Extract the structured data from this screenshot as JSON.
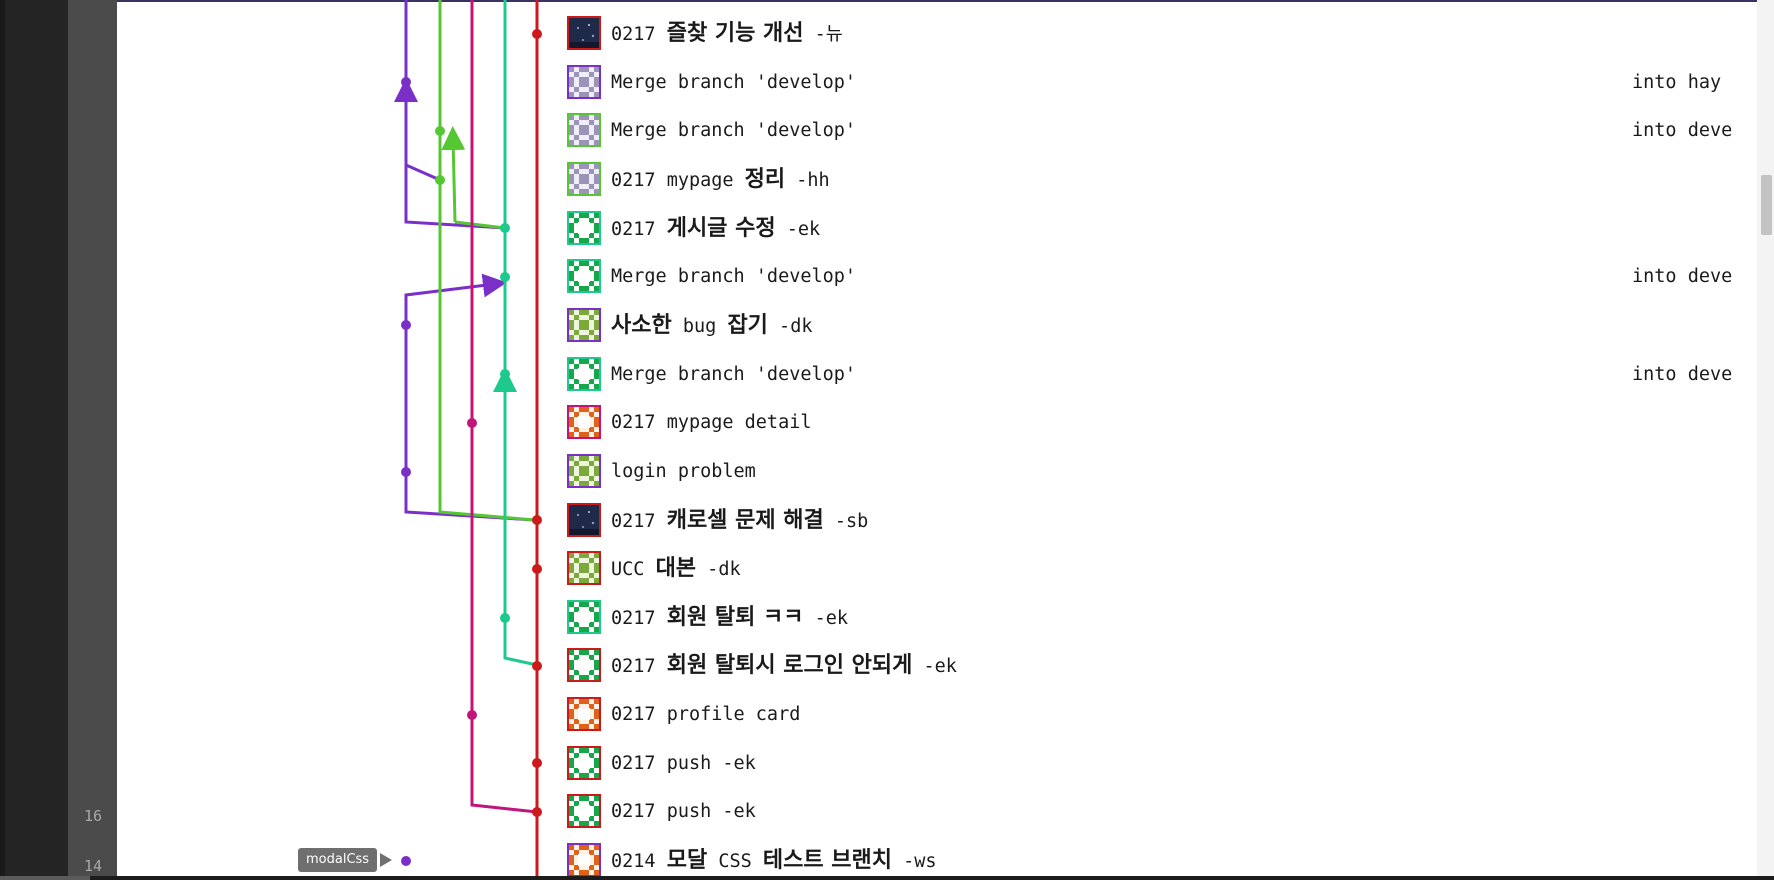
{
  "gutter": {
    "line_numbers": [
      "16",
      "14"
    ]
  },
  "tag": {
    "label": "modalCss"
  },
  "colors": {
    "purple": "#7a2fc9",
    "green": "#55c732",
    "magenta": "#c2147a",
    "teal": "#1dc98c",
    "red": "#cc1a1a"
  },
  "commits": [
    {
      "p": "0217 ",
      "k": "즐찾 기능 개선",
      "s": " -뉴",
      "into": "",
      "avatar": "photo",
      "frame": "#cc1a1a"
    },
    {
      "p": "Merge branch 'develop'",
      "k": "",
      "s": "",
      "into": "into hay",
      "avatar": "lavender",
      "frame": "#7a2fc9"
    },
    {
      "p": "Merge branch 'develop'",
      "k": "",
      "s": "",
      "into": "into deve",
      "avatar": "lavender",
      "frame": "#55c732"
    },
    {
      "p": "0217 mypage ",
      "k": "정리",
      "s": " -hh",
      "into": "",
      "avatar": "lavender",
      "frame": "#55c732"
    },
    {
      "p": "0217 ",
      "k": "게시글 수정",
      "s": " -ek",
      "into": "",
      "avatar": "green",
      "frame": "#1dc98c"
    },
    {
      "p": "Merge branch 'develop'",
      "k": "",
      "s": "",
      "into": "into deve",
      "avatar": "green",
      "frame": "#1dc98c"
    },
    {
      "p": "",
      "k": "사소한",
      "s": " bug ",
      "k2": "잡기",
      "s2": " -dk",
      "into": "",
      "avatar": "olive",
      "frame": "#7a2fc9"
    },
    {
      "p": "Merge branch 'develop'",
      "k": "",
      "s": "",
      "into": "into deve",
      "avatar": "green",
      "frame": "#1dc98c"
    },
    {
      "p": "0217 mypage detail",
      "k": "",
      "s": "",
      "into": "",
      "avatar": "orange",
      "frame": "#c2147a"
    },
    {
      "p": "login problem",
      "k": "",
      "s": "",
      "into": "",
      "avatar": "olive",
      "frame": "#7a2fc9"
    },
    {
      "p": "0217 ",
      "k": "캐로셀 문제 해결",
      "s": " -sb",
      "into": "",
      "avatar": "photo",
      "frame": "#cc1a1a"
    },
    {
      "p": "UCC ",
      "k": "대본",
      "s": " -dk",
      "into": "",
      "avatar": "olive",
      "frame": "#cc1a1a"
    },
    {
      "p": "0217 ",
      "k": "회원 탈퇴 ㅋㅋ",
      "s": " -ek",
      "into": "",
      "avatar": "green",
      "frame": "#1dc98c"
    },
    {
      "p": "0217 ",
      "k": "회원 탈퇴시 로그인 안되게",
      "s": " -ek",
      "into": "",
      "avatar": "green",
      "frame": "#cc1a1a"
    },
    {
      "p": "0217 profile card",
      "k": "",
      "s": "",
      "into": "",
      "avatar": "orange",
      "frame": "#cc1a1a"
    },
    {
      "p": "0217 push -ek",
      "k": "",
      "s": "",
      "into": "",
      "avatar": "green",
      "frame": "#cc1a1a"
    },
    {
      "p": "0217 push -ek",
      "k": "",
      "s": "",
      "into": "",
      "avatar": "green",
      "frame": "#cc1a1a"
    },
    {
      "p": "0214 ",
      "k": "모달",
      "s": " CSS ",
      "k2": "테스트 브랜치",
      "s2": " -ws",
      "into": "",
      "avatar": "orange",
      "frame": "#7a2fc9"
    }
  ]
}
